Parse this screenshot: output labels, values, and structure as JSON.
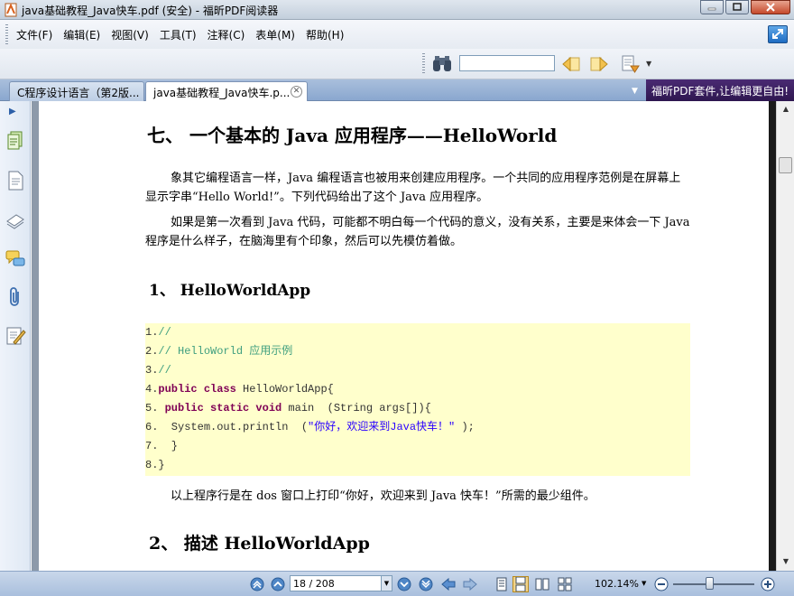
{
  "window": {
    "title": "java基础教程_Java快车.pdf (安全) - 福昕PDF阅读器"
  },
  "menu": {
    "items": [
      "文件(F)",
      "编辑(E)",
      "视图(V)",
      "工具(T)",
      "注释(C)",
      "表单(M)",
      "帮助(H)"
    ]
  },
  "toolbar": {
    "find_value": "",
    "icons": [
      "binoculars-icon",
      "prev-result-icon",
      "next-result-icon",
      "find-options-icon"
    ]
  },
  "tabs": [
    {
      "label": "C程序设计语言（第2版...",
      "active": false
    },
    {
      "label": "java基础教程_Java快车.p...",
      "active": true
    }
  ],
  "ad_banner": "福昕PDF套件,让编辑更自由!",
  "document": {
    "heading": "七、  一个基本的 Java 应用程序——HelloWorld",
    "para1": "象其它编程语言一样，Java  编程语言也被用来创建应用程序。一个共同的应用程序范例是在屏幕上显示字串“Hello World!”。下列代码给出了这个 Java 应用程序。",
    "para2": "如果是第一次看到 Java 代码，可能都不明白每一个代码的意义，没有关系，主要是来体会一下 Java 程序是什么样子，在脑海里有个印象，然后可以先模仿着做。",
    "section1": "1、 HelloWorldApp",
    "code": {
      "l1_num": "1.",
      "l1_comment": "//",
      "l2_num": "2.",
      "l2_comment": "// HelloWorld 应用示例",
      "l3_num": "3.",
      "l3_comment": "//",
      "l4_num": "4.",
      "l4_kw": "public class",
      "l4_rest": " HelloWorldApp{",
      "l5_num": "5.",
      "l5_kw": "public static void",
      "l5_rest": " main  (String args[]){",
      "l6_num": "6.",
      "l6_code": "  System.out.println  (",
      "l6_str": "\"你好，欢迎来到Java快车！\"",
      "l6_end": " );",
      "l7_num": "7.",
      "l7_code": "  }",
      "l8_num": "8.",
      "l8_code": "}"
    },
    "para3": "以上程序行是在 dos 窗口上打印“你好，欢迎来到 Java 快车！”所需的最少组件。",
    "section2": "2、 描述 HelloWorldApp"
  },
  "status": {
    "page_field": "18 / 208",
    "zoom": "102.14%",
    "zoom_slider_fraction": 0.45
  },
  "colors": {
    "code_background": "#ffffcc",
    "keyword": "#7f0055",
    "comment": "#3f9f7f",
    "string": "#2a00ff"
  }
}
